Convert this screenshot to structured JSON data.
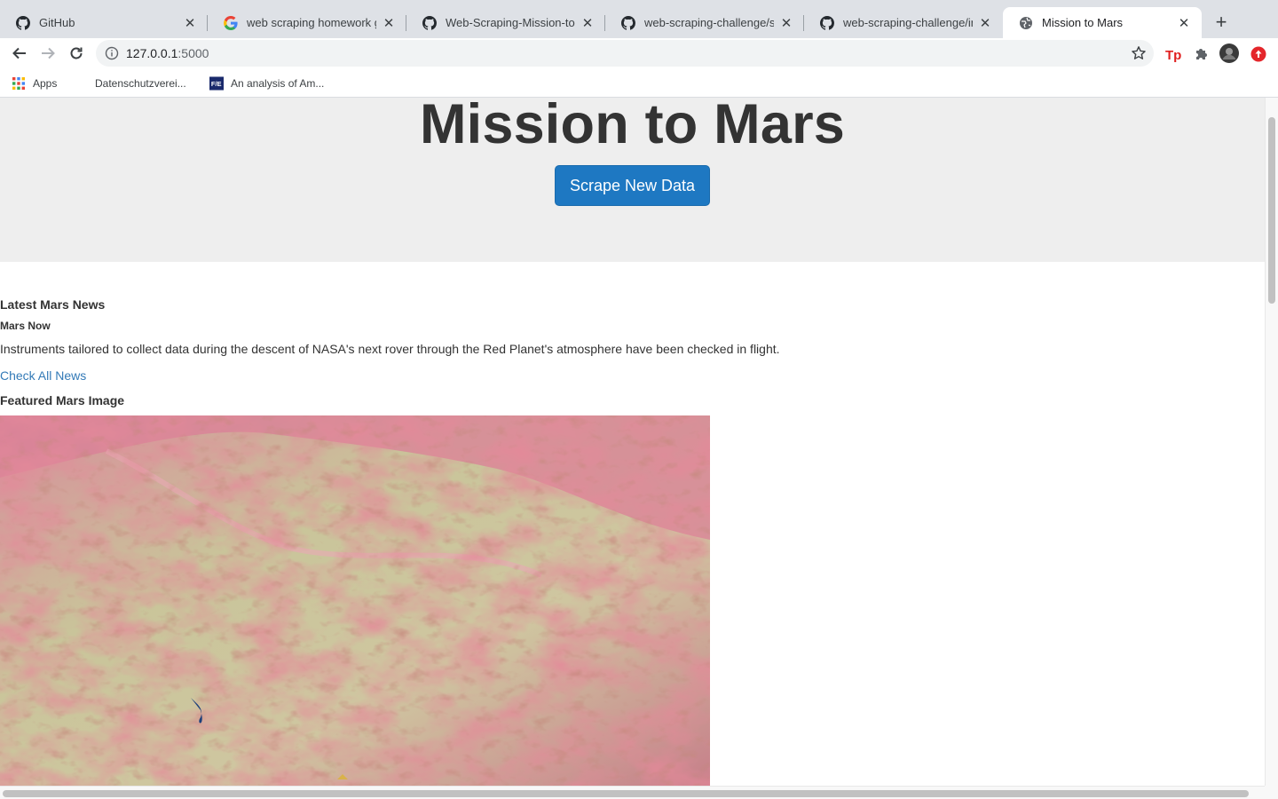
{
  "browser": {
    "tabs": [
      {
        "title": "GitHub",
        "favicon": "github-icon",
        "active": false
      },
      {
        "title": "web scraping homework gith",
        "favicon": "google-icon",
        "active": false
      },
      {
        "title": "Web-Scraping-Mission-to-M",
        "favicon": "github-icon",
        "active": false
      },
      {
        "title": "web-scraping-challenge/scr",
        "favicon": "github-icon",
        "active": false
      },
      {
        "title": "web-scraping-challenge/ind",
        "favicon": "github-icon",
        "active": false
      },
      {
        "title": "Mission to Mars",
        "favicon": "globe-icon",
        "active": true
      }
    ],
    "address": {
      "host": "127.0.0.1",
      "port": ":5000"
    },
    "bookmarks": [
      {
        "label": "Apps",
        "icon": "apps-grid-icon"
      },
      {
        "label": "Datenschutzverei...",
        "icon": ""
      },
      {
        "label": "An analysis of Am...",
        "icon": "bookmark-site-icon"
      }
    ]
  },
  "page": {
    "title": "Mission to Mars",
    "scrape_button": "Scrape New Data",
    "news": {
      "heading": "Latest Mars News",
      "title": "Mars Now",
      "paragraph": "Instruments tailored to collect data during the descent of NASA's next rover through the Red Planet's atmosphere have been checked in flight.",
      "link": "Check All News"
    },
    "featured_image": {
      "heading": "Featured Mars Image"
    }
  },
  "colors": {
    "accent": "#1e78c2",
    "link": "#337ab7",
    "jumbotron_bg": "#eeeeee",
    "text": "#333333"
  }
}
